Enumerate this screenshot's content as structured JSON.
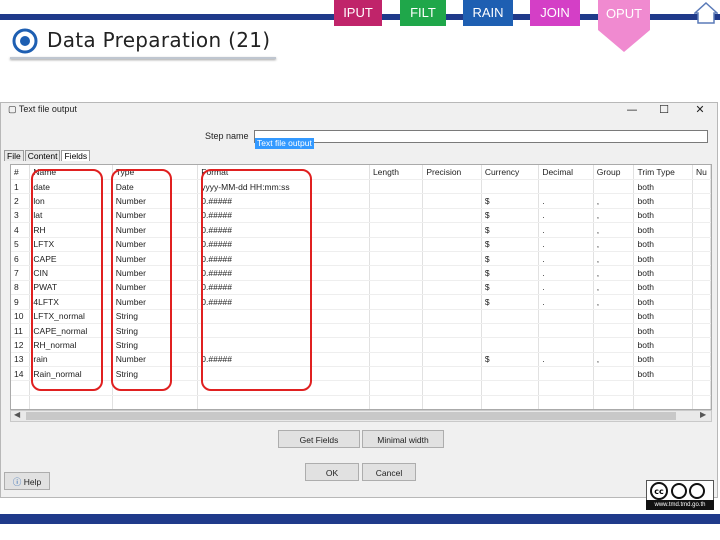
{
  "header": {
    "title": "Data Preparation (21)",
    "tabs": [
      {
        "label": "IPUT",
        "color": "#c0246a"
      },
      {
        "label": "FILT",
        "color": "#1fa74a"
      },
      {
        "label": "RAIN",
        "color": "#1e5fb2"
      },
      {
        "label": "JOIN",
        "color": "#d43fc6"
      },
      {
        "label": "OPUT",
        "color": "#f08ad0"
      }
    ]
  },
  "dialog": {
    "title": "Text file output",
    "step_name_label": "Step name",
    "step_name_value": "Text file output",
    "tabs": [
      "File",
      "Content",
      "Fields"
    ],
    "columns": [
      "#",
      "Name",
      "Type",
      "Format",
      "Length",
      "Precision",
      "Currency",
      "Decimal",
      "Group",
      "Trim Type",
      "Nu"
    ],
    "rows": [
      [
        "1",
        "date",
        "Date",
        "yyyy-MM-dd HH:mm:ss",
        "",
        "",
        "",
        "",
        "",
        "both"
      ],
      [
        "2",
        "lon",
        "Number",
        "0.#####",
        "",
        "",
        "$",
        ".",
        ",",
        "both"
      ],
      [
        "3",
        "lat",
        "Number",
        "0.#####",
        "",
        "",
        "$",
        ".",
        ",",
        "both"
      ],
      [
        "4",
        "RH",
        "Number",
        "0.#####",
        "",
        "",
        "$",
        ".",
        ",",
        "both"
      ],
      [
        "5",
        "LFTX",
        "Number",
        "0.#####",
        "",
        "",
        "$",
        ".",
        ",",
        "both"
      ],
      [
        "6",
        "CAPE",
        "Number",
        "0.#####",
        "",
        "",
        "$",
        ".",
        ",",
        "both"
      ],
      [
        "7",
        "CIN",
        "Number",
        "0.#####",
        "",
        "",
        "$",
        ".",
        ",",
        "both"
      ],
      [
        "8",
        "PWAT",
        "Number",
        "0.#####",
        "",
        "",
        "$",
        ".",
        ",",
        "both"
      ],
      [
        "9",
        "4LFTX",
        "Number",
        "0.#####",
        "",
        "",
        "$",
        ".",
        ",",
        "both"
      ],
      [
        "10",
        "LFTX_normal",
        "String",
        "",
        "",
        "",
        "",
        "",
        "",
        "both"
      ],
      [
        "11",
        "CAPE_normal",
        "String",
        "",
        "",
        "",
        "",
        "",
        "",
        "both"
      ],
      [
        "12",
        "RH_normal",
        "String",
        "",
        "",
        "",
        "",
        "",
        "",
        "both"
      ],
      [
        "13",
        "rain",
        "Number",
        "0.#####",
        "",
        "",
        "$",
        ".",
        ",",
        "both"
      ],
      [
        "14",
        "Rain_normal",
        "String",
        "",
        "",
        "",
        "",
        "",
        "",
        "both"
      ]
    ],
    "get_fields_label": "Get Fields",
    "minimal_width_label": "Minimal width",
    "ok_label": "OK",
    "cancel_label": "Cancel",
    "help_label": "Help"
  },
  "footer": {
    "license_url": "www.tmd.tmd.go.th"
  }
}
